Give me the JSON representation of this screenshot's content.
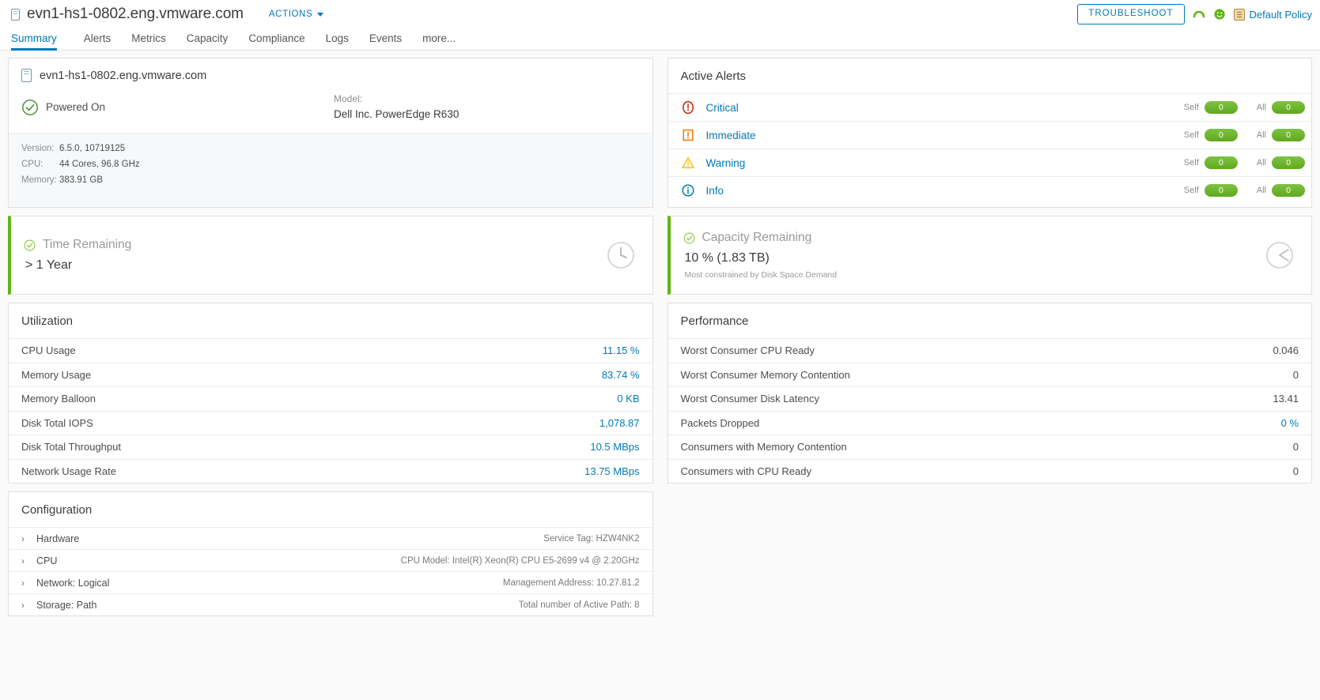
{
  "header": {
    "host_name": "evn1-hs1-0802.eng.vmware.com",
    "actions_label": "ACTIONS",
    "troubleshoot_label": "TROUBLESHOOT",
    "policy_label": "Default Policy",
    "accent_color": "#0079b8",
    "health_color": "#60b515"
  },
  "tabs": [
    {
      "label": "Summary",
      "active": true
    },
    {
      "label": "Alerts",
      "active": false
    },
    {
      "label": "Metrics",
      "active": false
    },
    {
      "label": "Capacity",
      "active": false
    },
    {
      "label": "Compliance",
      "active": false
    },
    {
      "label": "Logs",
      "active": false
    },
    {
      "label": "Events",
      "active": false
    },
    {
      "label": "more...",
      "active": false
    }
  ],
  "host_card": {
    "name": "evn1-hs1-0802.eng.vmware.com",
    "power_state": "Powered On",
    "model_label": "Model:",
    "model_value": "Dell Inc. PowerEdge R630",
    "properties": [
      {
        "key": "Version:",
        "value": "6.5.0, 10719125"
      },
      {
        "key": "CPU:",
        "value": "44 Cores, 96.8 GHz"
      },
      {
        "key": "Memory:",
        "value": "383.91 GB"
      }
    ]
  },
  "active_alerts": {
    "title": "Active Alerts",
    "self_label": "Self",
    "all_label": "All",
    "rows": [
      {
        "name": "Critical",
        "icon": "critical-icon",
        "self": "0",
        "all": "0"
      },
      {
        "name": "Immediate",
        "icon": "immediate-icon",
        "self": "0",
        "all": "0"
      },
      {
        "name": "Warning",
        "icon": "warning-icon",
        "self": "0",
        "all": "0"
      },
      {
        "name": "Info",
        "icon": "info-icon",
        "self": "0",
        "all": "0"
      }
    ]
  },
  "time_remaining": {
    "title": "Time Remaining",
    "value": "> 1 Year",
    "sub": ""
  },
  "capacity_remaining": {
    "title": "Capacity Remaining",
    "value": "10 % (1.83 TB)",
    "sub": "Most constrained by Disk Space Demand"
  },
  "utilization": {
    "title": "Utilization",
    "rows": [
      {
        "name": "CPU Usage",
        "value": "11.15 %"
      },
      {
        "name": "Memory Usage",
        "value": "83.74 %"
      },
      {
        "name": "Memory Balloon",
        "value": "0 KB"
      },
      {
        "name": "Disk Total IOPS",
        "value": "1,078.87"
      },
      {
        "name": "Disk Total Throughput",
        "value": "10.5 MBps"
      },
      {
        "name": "Network Usage Rate",
        "value": "13.75 MBps"
      }
    ]
  },
  "performance": {
    "title": "Performance",
    "rows": [
      {
        "name": "Worst Consumer CPU Ready",
        "value": "0.046",
        "link": false
      },
      {
        "name": "Worst Consumer Memory Contention",
        "value": "0",
        "link": false
      },
      {
        "name": "Worst Consumer Disk Latency",
        "value": "13.41",
        "link": false
      },
      {
        "name": "Packets Dropped",
        "value": "0 %",
        "link": true
      },
      {
        "name": "Consumers with Memory Contention",
        "value": "0",
        "link": false
      },
      {
        "name": "Consumers with CPU Ready",
        "value": "0",
        "link": false
      }
    ]
  },
  "configuration": {
    "title": "Configuration",
    "rows": [
      {
        "name": "Hardware",
        "detail": "Service Tag: HZW4NK2"
      },
      {
        "name": "CPU",
        "detail": "CPU Model: Intel(R) Xeon(R) CPU E5-2699 v4 @ 2.20GHz"
      },
      {
        "name": "Network: Logical",
        "detail": "Management Address: 10.27.81.2"
      },
      {
        "name": "Storage: Path",
        "detail": "Total number of Active Path: 8"
      }
    ]
  }
}
